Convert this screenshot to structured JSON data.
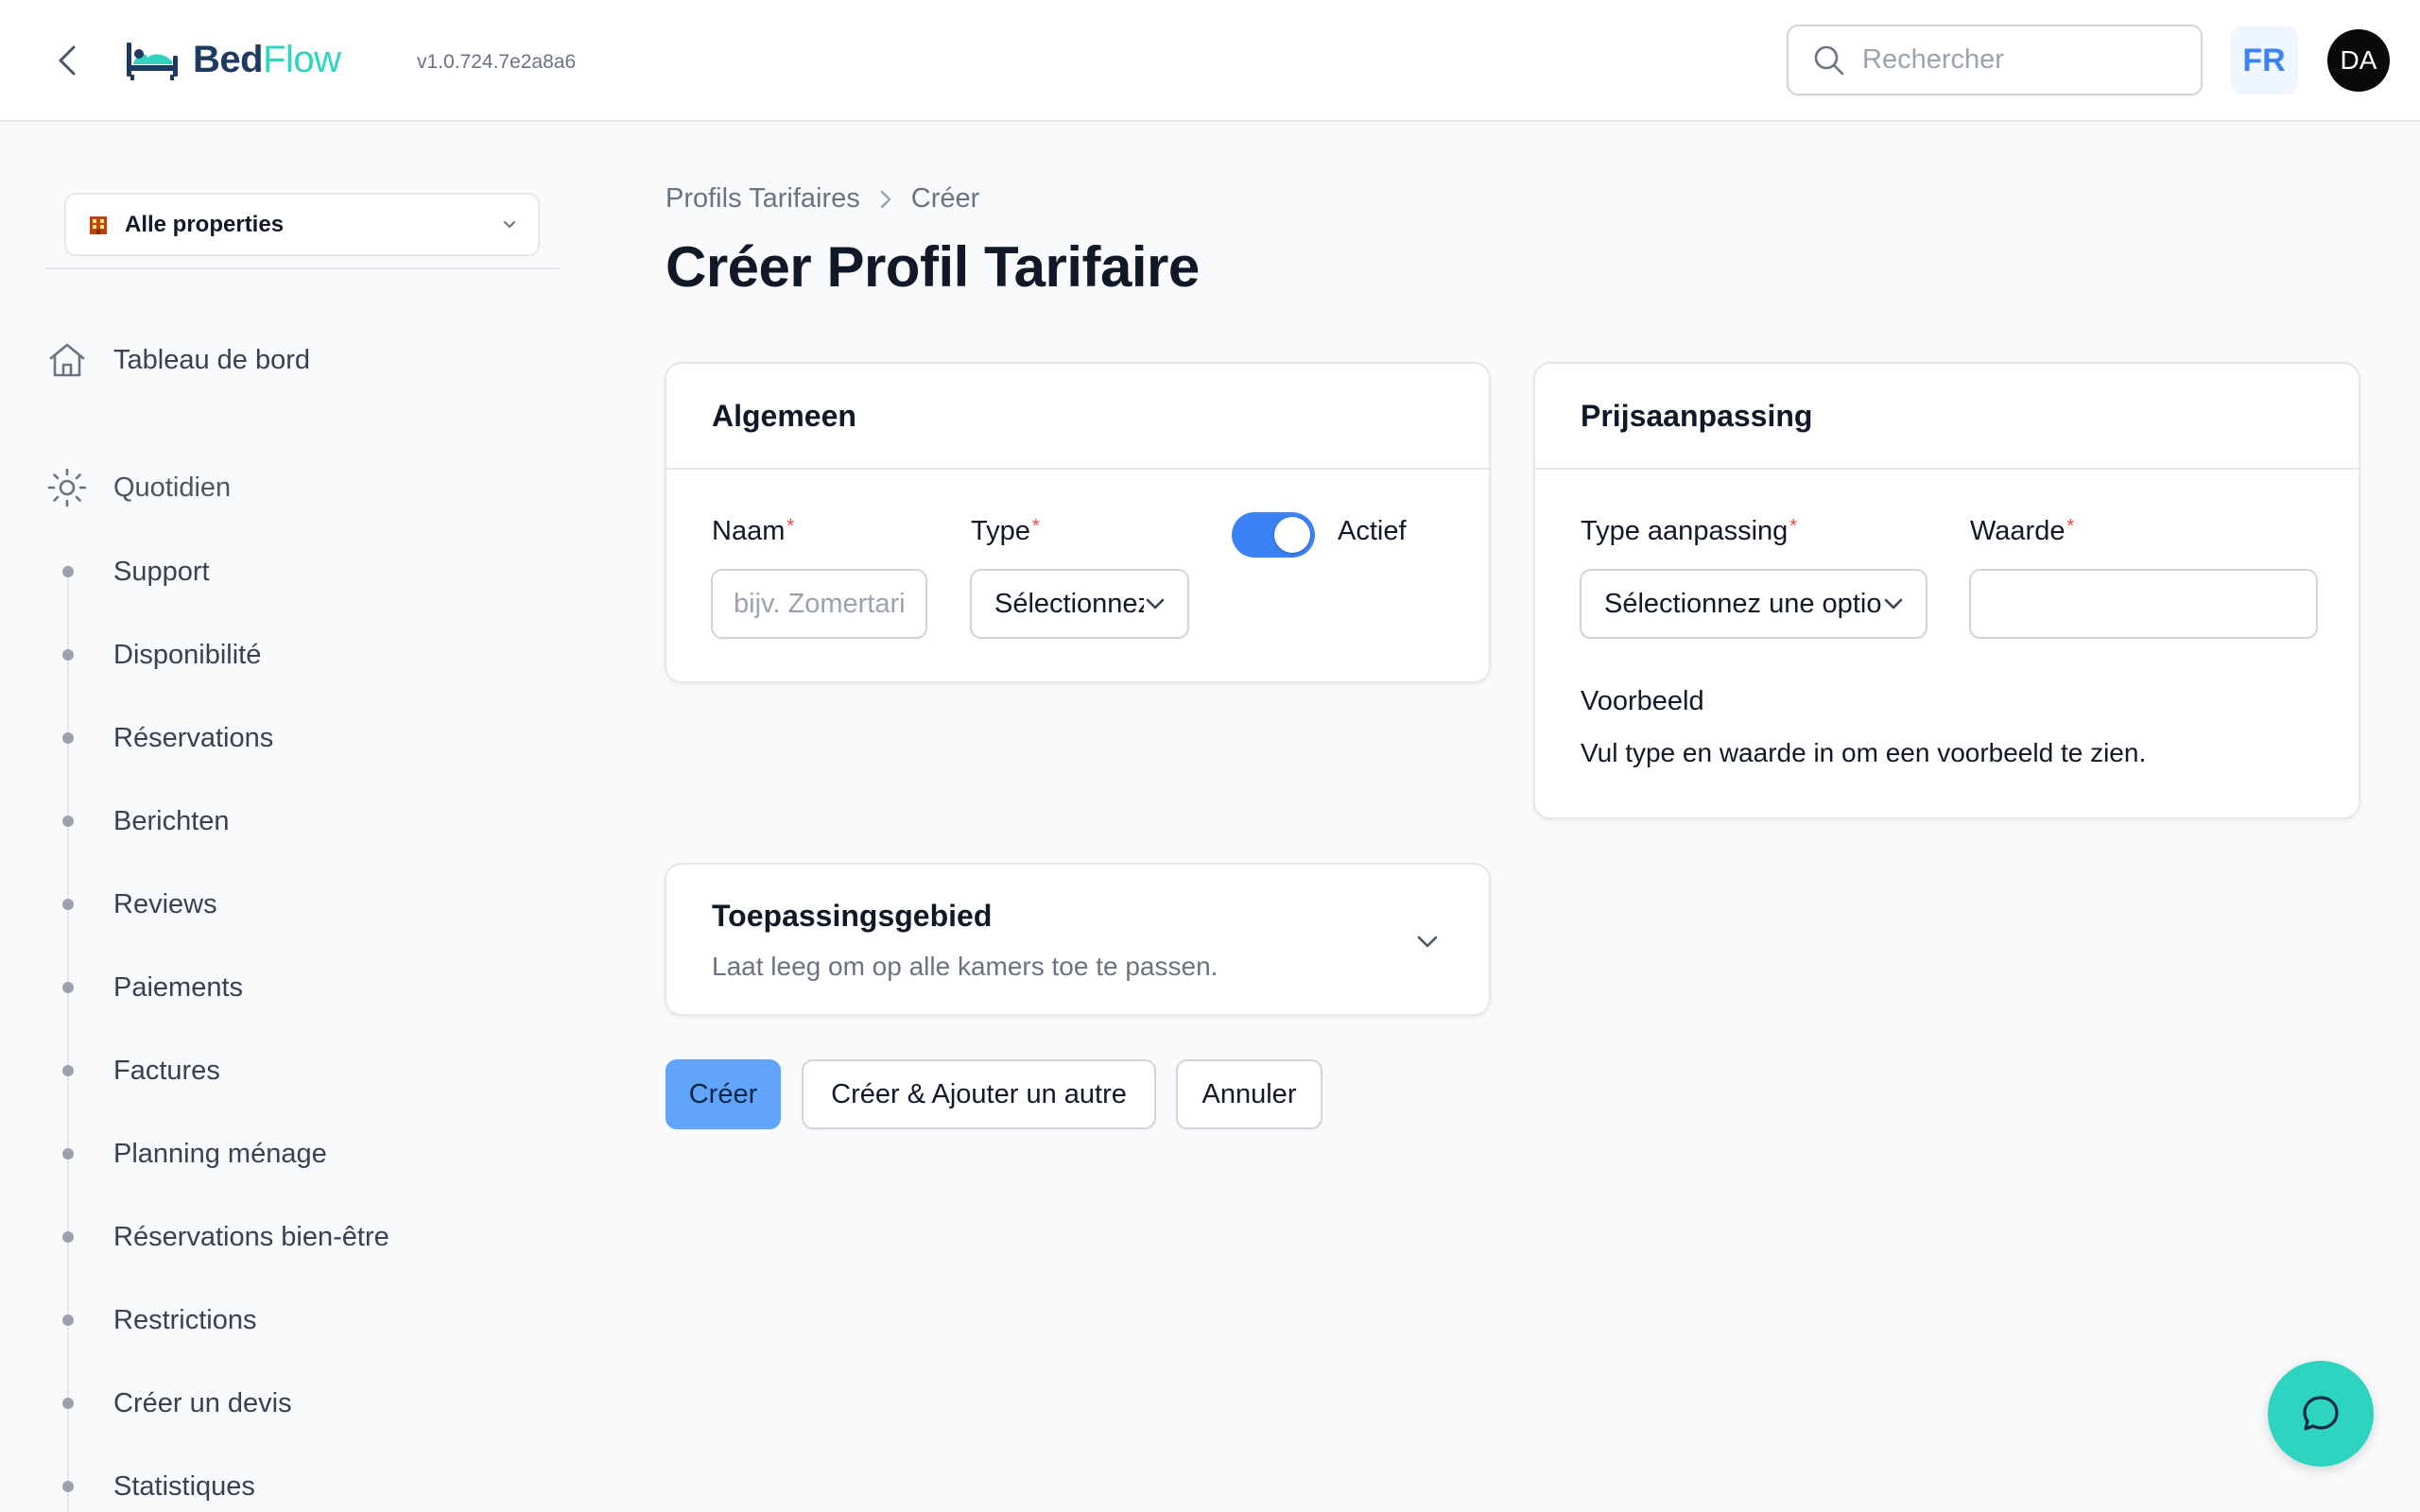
{
  "app": {
    "brand_part1": "Bed",
    "brand_part2": "Flow",
    "version": "v1.0.724.7e2a8a6"
  },
  "header": {
    "search_placeholder": "Rechercher",
    "language": "FR",
    "avatar_initials": "DA"
  },
  "sidebar": {
    "property_select": "Alle properties",
    "dashboard": "Tableau de bord",
    "group_label": "Quotidien",
    "items": [
      {
        "label": "Support"
      },
      {
        "label": "Disponibilité"
      },
      {
        "label": "Réservations"
      },
      {
        "label": "Berichten"
      },
      {
        "label": "Reviews"
      },
      {
        "label": "Paiements"
      },
      {
        "label": "Factures"
      },
      {
        "label": "Planning ménage"
      },
      {
        "label": "Réservations bien-être"
      },
      {
        "label": "Restrictions"
      },
      {
        "label": "Créer un devis"
      },
      {
        "label": "Statistiques"
      }
    ]
  },
  "breadcrumb": {
    "parent": "Profils Tarifaires",
    "current": "Créer"
  },
  "page": {
    "title": "Créer Profil Tarifaire"
  },
  "general_card": {
    "title": "Algemeen",
    "name_label": "Naam",
    "name_placeholder": "bijv. Zomertarief",
    "type_label": "Type",
    "type_value": "Sélectionnez une option",
    "active_label": "Actief",
    "active_on": true
  },
  "price_card": {
    "title": "Prijsaanpassing",
    "adjustment_type_label": "Type aanpassing",
    "adjustment_type_value": "Sélectionnez une option",
    "value_label": "Waarde",
    "value": "",
    "preview_label": "Voorbeeld",
    "preview_text": "Vul type en waarde in om een voorbeeld te zien."
  },
  "scope_card": {
    "title": "Toepassingsgebied",
    "description": "Laat leeg om op alle kamers toe te passen."
  },
  "actions": {
    "create": "Créer",
    "create_another": "Créer & Ajouter un autre",
    "cancel": "Annuler"
  },
  "colors": {
    "accent": "#3b82f6",
    "brand_teal": "#2dd4bf",
    "primary_button": "#60a5fa",
    "required": "#ef4444"
  },
  "icons": {
    "back": "chevron-left-icon",
    "logo": "bed-icon",
    "search": "search-icon",
    "property": "building-icon",
    "dashboard": "home-icon",
    "group": "sun-icon",
    "chat": "chat-bubble-icon"
  }
}
